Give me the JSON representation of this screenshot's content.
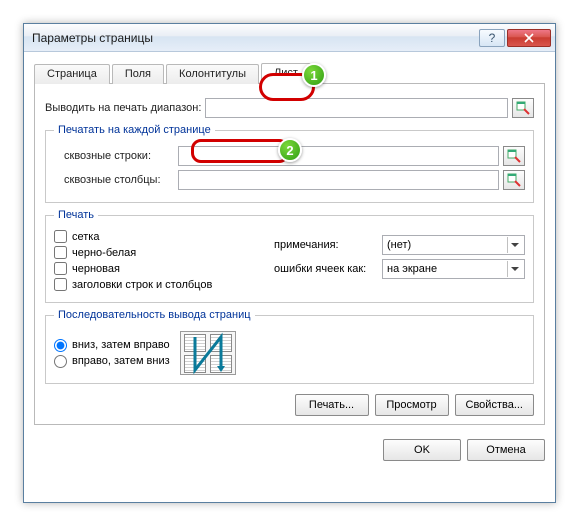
{
  "title": "Параметры страницы",
  "tabs": {
    "page": "Страница",
    "fields": "Поля",
    "headers": "Колонтитулы",
    "sheet": "Лист"
  },
  "labels": {
    "printRange": "Выводить на печать диапазон:",
    "repeatEach": "Печатать на каждой странице",
    "rows": "сквозные строки:",
    "cols": "сквозные столбцы:",
    "printGroup": "Печать",
    "grid": "сетка",
    "bw": "черно-белая",
    "draft": "черновая",
    "rcHeaders": "заголовки строк и столбцов",
    "comments": "примечания:",
    "errors": "ошибки ячеек как:",
    "order": "Последовательность вывода страниц",
    "downRight": "вниз, затем вправо",
    "rightDown": "вправо, затем вниз"
  },
  "values": {
    "comments": "(нет)",
    "errors": "на экране"
  },
  "buttons": {
    "print": "Печать...",
    "preview": "Просмотр",
    "props": "Свойства...",
    "ok": "OK",
    "cancel": "Отмена"
  },
  "badges": {
    "b1": "1",
    "b2": "2"
  }
}
